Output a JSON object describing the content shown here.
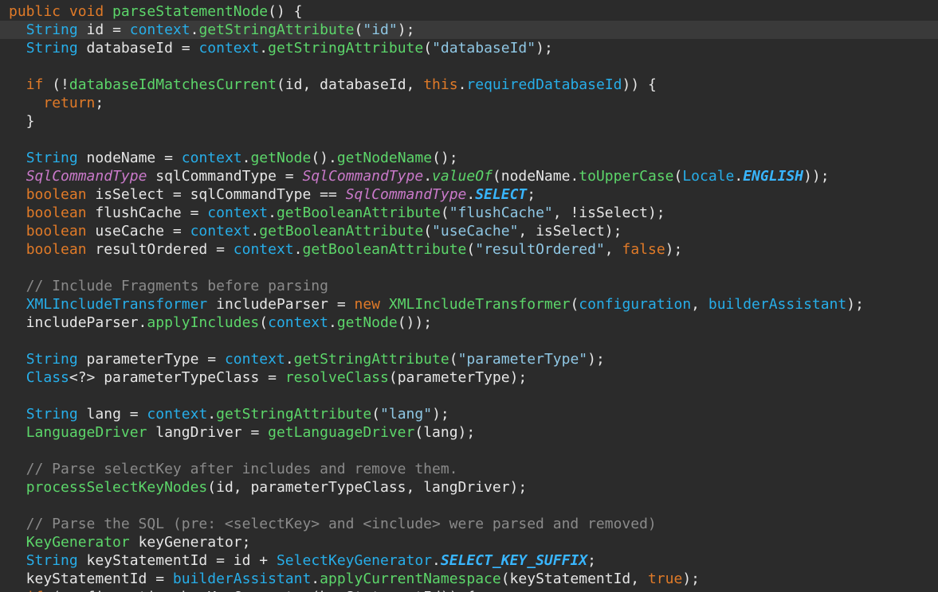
{
  "editor": {
    "highlighted_line": 2,
    "lines": [
      [
        {
          "t": "public void ",
          "c": "kw"
        },
        {
          "t": "parseStatementNode",
          "c": "fn"
        },
        {
          "t": "() {",
          "c": "id"
        }
      ],
      [
        {
          "t": "  ",
          "c": "id"
        },
        {
          "t": "String",
          "c": "type"
        },
        {
          "t": " id = ",
          "c": "id"
        },
        {
          "t": "context",
          "c": "type"
        },
        {
          "t": ".",
          "c": "id"
        },
        {
          "t": "getStringAttribute",
          "c": "fn"
        },
        {
          "t": "(",
          "c": "id"
        },
        {
          "t": "\"id\"",
          "c": "str"
        },
        {
          "t": ");",
          "c": "id"
        }
      ],
      [
        {
          "t": "  ",
          "c": "id"
        },
        {
          "t": "String",
          "c": "type"
        },
        {
          "t": " databaseId = ",
          "c": "id"
        },
        {
          "t": "context",
          "c": "type"
        },
        {
          "t": ".",
          "c": "id"
        },
        {
          "t": "getStringAttribute",
          "c": "fn"
        },
        {
          "t": "(",
          "c": "id"
        },
        {
          "t": "\"databaseId\"",
          "c": "str"
        },
        {
          "t": ");",
          "c": "id"
        }
      ],
      [],
      [
        {
          "t": "  ",
          "c": "id"
        },
        {
          "t": "if",
          "c": "kw"
        },
        {
          "t": " (!",
          "c": "id"
        },
        {
          "t": "databaseIdMatchesCurrent",
          "c": "fn"
        },
        {
          "t": "(id, databaseId, ",
          "c": "id"
        },
        {
          "t": "this",
          "c": "kw"
        },
        {
          "t": ".",
          "c": "id"
        },
        {
          "t": "requiredDatabaseId",
          "c": "type"
        },
        {
          "t": ")) {",
          "c": "id"
        }
      ],
      [
        {
          "t": "    ",
          "c": "id"
        },
        {
          "t": "return",
          "c": "kw"
        },
        {
          "t": ";",
          "c": "id"
        }
      ],
      [
        {
          "t": "  }",
          "c": "id"
        }
      ],
      [],
      [
        {
          "t": "  ",
          "c": "id"
        },
        {
          "t": "String",
          "c": "type"
        },
        {
          "t": " nodeName = ",
          "c": "id"
        },
        {
          "t": "context",
          "c": "type"
        },
        {
          "t": ".",
          "c": "id"
        },
        {
          "t": "getNode",
          "c": "fn"
        },
        {
          "t": "().",
          "c": "id"
        },
        {
          "t": "getNodeName",
          "c": "fn"
        },
        {
          "t": "();",
          "c": "id"
        }
      ],
      [
        {
          "t": "  ",
          "c": "id"
        },
        {
          "t": "SqlCommandType",
          "c": "it"
        },
        {
          "t": " sqlCommandType = ",
          "c": "id"
        },
        {
          "t": "SqlCommandType",
          "c": "it"
        },
        {
          "t": ".",
          "c": "id"
        },
        {
          "t": "valueOf",
          "c": "fnit"
        },
        {
          "t": "(nodeName.",
          "c": "id"
        },
        {
          "t": "toUpperCase",
          "c": "fn"
        },
        {
          "t": "(",
          "c": "id"
        },
        {
          "t": "Locale",
          "c": "type"
        },
        {
          "t": ".",
          "c": "id"
        },
        {
          "t": "ENGLISH",
          "c": "bi"
        },
        {
          "t": "));",
          "c": "id"
        }
      ],
      [
        {
          "t": "  ",
          "c": "id"
        },
        {
          "t": "boolean",
          "c": "kw"
        },
        {
          "t": " isSelect = sqlCommandType == ",
          "c": "id"
        },
        {
          "t": "SqlCommandType",
          "c": "it"
        },
        {
          "t": ".",
          "c": "id"
        },
        {
          "t": "SELECT",
          "c": "bi"
        },
        {
          "t": ";",
          "c": "id"
        }
      ],
      [
        {
          "t": "  ",
          "c": "id"
        },
        {
          "t": "boolean",
          "c": "kw"
        },
        {
          "t": " flushCache = ",
          "c": "id"
        },
        {
          "t": "context",
          "c": "type"
        },
        {
          "t": ".",
          "c": "id"
        },
        {
          "t": "getBooleanAttribute",
          "c": "fn"
        },
        {
          "t": "(",
          "c": "id"
        },
        {
          "t": "\"flushCache\"",
          "c": "str"
        },
        {
          "t": ", !isSelect);",
          "c": "id"
        }
      ],
      [
        {
          "t": "  ",
          "c": "id"
        },
        {
          "t": "boolean",
          "c": "kw"
        },
        {
          "t": " useCache = ",
          "c": "id"
        },
        {
          "t": "context",
          "c": "type"
        },
        {
          "t": ".",
          "c": "id"
        },
        {
          "t": "getBooleanAttribute",
          "c": "fn"
        },
        {
          "t": "(",
          "c": "id"
        },
        {
          "t": "\"useCache\"",
          "c": "str"
        },
        {
          "t": ", isSelect);",
          "c": "id"
        }
      ],
      [
        {
          "t": "  ",
          "c": "id"
        },
        {
          "t": "boolean",
          "c": "kw"
        },
        {
          "t": " resultOrdered = ",
          "c": "id"
        },
        {
          "t": "context",
          "c": "type"
        },
        {
          "t": ".",
          "c": "id"
        },
        {
          "t": "getBooleanAttribute",
          "c": "fn"
        },
        {
          "t": "(",
          "c": "id"
        },
        {
          "t": "\"resultOrdered\"",
          "c": "str"
        },
        {
          "t": ", ",
          "c": "id"
        },
        {
          "t": "false",
          "c": "kw"
        },
        {
          "t": ");",
          "c": "id"
        }
      ],
      [],
      [
        {
          "t": "  // Include Fragments before parsing",
          "c": "cmt"
        }
      ],
      [
        {
          "t": "  ",
          "c": "id"
        },
        {
          "t": "XMLIncludeTransformer",
          "c": "type"
        },
        {
          "t": " includeParser = ",
          "c": "id"
        },
        {
          "t": "new",
          "c": "kw"
        },
        {
          "t": " ",
          "c": "id"
        },
        {
          "t": "XMLIncludeTransformer",
          "c": "fn"
        },
        {
          "t": "(",
          "c": "id"
        },
        {
          "t": "configuration",
          "c": "type"
        },
        {
          "t": ", ",
          "c": "id"
        },
        {
          "t": "builderAssistant",
          "c": "type"
        },
        {
          "t": ");",
          "c": "id"
        }
      ],
      [
        {
          "t": "  includeParser.",
          "c": "id"
        },
        {
          "t": "applyIncludes",
          "c": "fn"
        },
        {
          "t": "(",
          "c": "id"
        },
        {
          "t": "context",
          "c": "type"
        },
        {
          "t": ".",
          "c": "id"
        },
        {
          "t": "getNode",
          "c": "fn"
        },
        {
          "t": "());",
          "c": "id"
        }
      ],
      [],
      [
        {
          "t": "  ",
          "c": "id"
        },
        {
          "t": "String",
          "c": "type"
        },
        {
          "t": " parameterType = ",
          "c": "id"
        },
        {
          "t": "context",
          "c": "type"
        },
        {
          "t": ".",
          "c": "id"
        },
        {
          "t": "getStringAttribute",
          "c": "fn"
        },
        {
          "t": "(",
          "c": "id"
        },
        {
          "t": "\"parameterType\"",
          "c": "str"
        },
        {
          "t": ");",
          "c": "id"
        }
      ],
      [
        {
          "t": "  ",
          "c": "id"
        },
        {
          "t": "Class",
          "c": "type"
        },
        {
          "t": "<?> parameterTypeClass = ",
          "c": "id"
        },
        {
          "t": "resolveClass",
          "c": "fn"
        },
        {
          "t": "(parameterType);",
          "c": "id"
        }
      ],
      [],
      [
        {
          "t": "  ",
          "c": "id"
        },
        {
          "t": "String",
          "c": "type"
        },
        {
          "t": " lang = ",
          "c": "id"
        },
        {
          "t": "context",
          "c": "type"
        },
        {
          "t": ".",
          "c": "id"
        },
        {
          "t": "getStringAttribute",
          "c": "fn"
        },
        {
          "t": "(",
          "c": "id"
        },
        {
          "t": "\"lang\"",
          "c": "str"
        },
        {
          "t": ");",
          "c": "id"
        }
      ],
      [
        {
          "t": "  ",
          "c": "id"
        },
        {
          "t": "LanguageDriver",
          "c": "fn"
        },
        {
          "t": " langDriver = ",
          "c": "id"
        },
        {
          "t": "getLanguageDriver",
          "c": "fn"
        },
        {
          "t": "(lang);",
          "c": "id"
        }
      ],
      [],
      [
        {
          "t": "  // Parse selectKey after includes and remove them.",
          "c": "cmt"
        }
      ],
      [
        {
          "t": "  ",
          "c": "id"
        },
        {
          "t": "processSelectKeyNodes",
          "c": "fn"
        },
        {
          "t": "(id, parameterTypeClass, langDriver);",
          "c": "id"
        }
      ],
      [],
      [
        {
          "t": "  // Parse the SQL (pre: <selectKey> and <include> were parsed and removed)",
          "c": "cmt"
        }
      ],
      [
        {
          "t": "  ",
          "c": "id"
        },
        {
          "t": "KeyGenerator",
          "c": "fn"
        },
        {
          "t": " keyGenerator;",
          "c": "id"
        }
      ],
      [
        {
          "t": "  ",
          "c": "id"
        },
        {
          "t": "String",
          "c": "type"
        },
        {
          "t": " keyStatementId = id + ",
          "c": "id"
        },
        {
          "t": "SelectKeyGenerator",
          "c": "type"
        },
        {
          "t": ".",
          "c": "id"
        },
        {
          "t": "SELECT_KEY_SUFFIX",
          "c": "bi"
        },
        {
          "t": ";",
          "c": "id"
        }
      ],
      [
        {
          "t": "  keyStatementId = ",
          "c": "id"
        },
        {
          "t": "builderAssistant",
          "c": "type"
        },
        {
          "t": ".",
          "c": "id"
        },
        {
          "t": "applyCurrentNamespace",
          "c": "fn"
        },
        {
          "t": "(keyStatementId, ",
          "c": "id"
        },
        {
          "t": "true",
          "c": "kw"
        },
        {
          "t": ");",
          "c": "id"
        }
      ],
      [
        {
          "t": "  ",
          "c": "id"
        },
        {
          "t": "if",
          "c": "kw"
        },
        {
          "t": " (configuration.hasKeyGenerator(keyStatementId)) {",
          "c": "id"
        }
      ]
    ]
  }
}
